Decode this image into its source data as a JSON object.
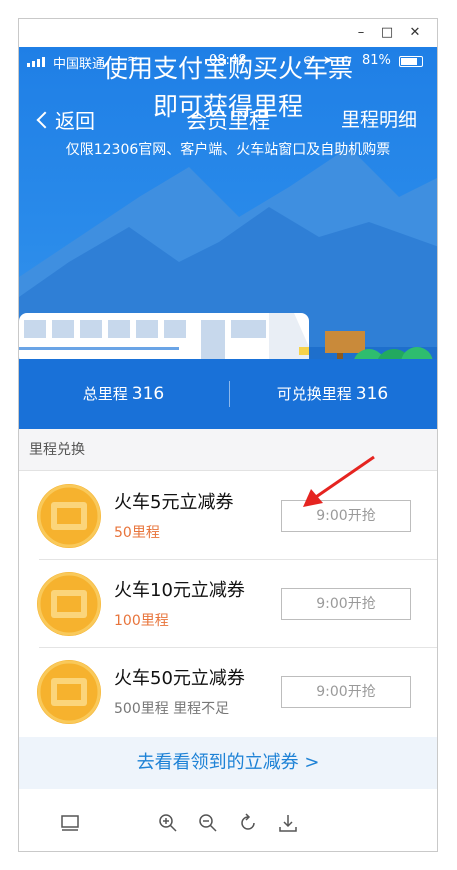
{
  "window": {
    "minimize": "–",
    "maximize": "□",
    "close": "✕"
  },
  "status_bar": {
    "carrier": "中国联通",
    "time": "08:48",
    "battery": "81%"
  },
  "banner": {
    "line1": "使用支付宝购买火车票",
    "line2": "即可获得里程"
  },
  "nav": {
    "back": "返回",
    "title": "会员里程",
    "right": "里程明细"
  },
  "subtitle": "仅限12306官网、客户端、火车站窗口及自助机购票",
  "stats": {
    "total_label": "总里程",
    "total_value": "316",
    "redeemable_label": "可兑换里程",
    "redeemable_value": "316"
  },
  "section_title": "里程兑换",
  "coupons": [
    {
      "title": "火车5元立减券",
      "sub": "50里程",
      "sub_color": "#e8743b",
      "button": "9:00开抢"
    },
    {
      "title": "火车10元立减券",
      "sub": "100里程",
      "sub_color": "#e8743b",
      "button": "9:00开抢"
    },
    {
      "title": "火车50元立减券",
      "sub": "500里程 里程不足",
      "sub_color": "#777777",
      "button": "9:00开抢"
    }
  ],
  "footer_link": "去看看领到的立减券 >",
  "toolbar_icons": [
    "monitor-icon",
    "zoom-in-icon",
    "zoom-out-icon",
    "rotate-icon",
    "download-icon"
  ],
  "colors": {
    "brand_blue": "#1f7fe6",
    "link_blue": "#1e82d6",
    "coin_orange": "#f6b22e",
    "arrow_red": "#e52420"
  }
}
